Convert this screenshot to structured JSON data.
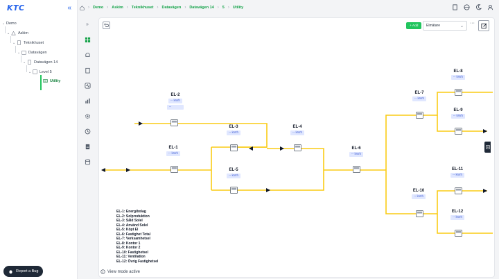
{
  "app": {
    "logo": "KTC",
    "collapse_icon": "double-chevron-left-icon"
  },
  "tree": {
    "nodes": [
      {
        "label": "Demo",
        "level": 0,
        "icon": "none"
      },
      {
        "label": "Askim",
        "level": 1,
        "icon": "building-icon"
      },
      {
        "label": "Teknikhuset",
        "level": 2,
        "icon": "building-icon"
      },
      {
        "label": "Datavägen",
        "level": 3,
        "icon": "folder-icon"
      },
      {
        "label": "Datavägen 14",
        "level": 4,
        "icon": "building-icon"
      },
      {
        "label": "Level 5",
        "level": 5,
        "icon": "floor-icon"
      },
      {
        "label": "Utility",
        "level": 6,
        "icon": "utility-icon",
        "active": true
      }
    ],
    "report_bug": "Report a Bug"
  },
  "breadcrumb": [
    "Demo",
    "Askim",
    "Teknikhuset",
    "Datavägen",
    "Datavägen 14",
    "5",
    "Utility"
  ],
  "toolbar": {
    "add_label": "+ Add",
    "select_value": "Elmätare",
    "more_label": "···"
  },
  "meters": [
    {
      "id": "el2",
      "name": "EL-2",
      "value": "-- kWh",
      "extra": "--"
    },
    {
      "id": "el1",
      "name": "EL-1",
      "value": "-- kWh"
    },
    {
      "id": "el3",
      "name": "EL-3",
      "value": "-- kWh"
    },
    {
      "id": "el4",
      "name": "EL-4",
      "value": "-- kWh"
    },
    {
      "id": "el5",
      "name": "EL-5",
      "value": "-- kWh"
    },
    {
      "id": "el6",
      "name": "EL-6",
      "value": "-- kWh"
    },
    {
      "id": "el7",
      "name": "EL-7",
      "value": "-- kWh"
    },
    {
      "id": "el8",
      "name": "EL-8",
      "value": "-- kWh"
    },
    {
      "id": "el9",
      "name": "EL-9",
      "value": "-- kWh"
    },
    {
      "id": "el10",
      "name": "EL-10",
      "value": "-- kWh"
    },
    {
      "id": "el11",
      "name": "EL-11",
      "value": "-- kWh"
    },
    {
      "id": "el12",
      "name": "EL-12",
      "value": "-- kWh"
    }
  ],
  "legend": [
    "EL-1: Energibolag",
    "EL-2: Solproduktion",
    "EL-3: Såld Solel",
    "EL-4: Använd Solel",
    "EL-5: Köpt El",
    "EL-6: Fastighet Total",
    "EL-7: Verksamhetsel",
    "EL-8: Kontor 1",
    "EL-9: Kontor 2",
    "EL-10: Fastighetsel",
    "EL-11: Ventilation",
    "EL-12: Övrig Fastighetsel"
  ],
  "status": {
    "view_mode": "View mode active"
  },
  "colors": {
    "accent": "#16a34a",
    "line": "#facc15",
    "badge_bg": "#e0e7ff",
    "badge_text": "#4f6bd8"
  }
}
